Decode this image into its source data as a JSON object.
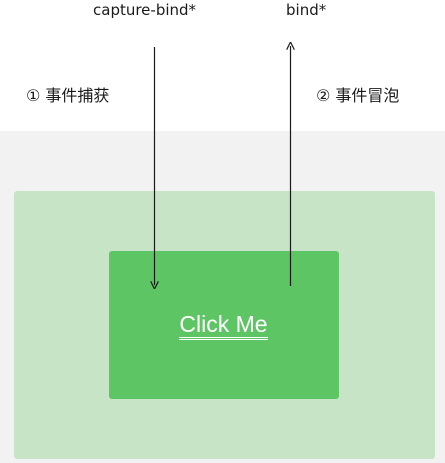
{
  "labels": {
    "capture_bind": "capture-bind*",
    "bind": "bind*",
    "capture_phase": "① 事件捕获",
    "bubble_phase": "② 事件冒泡"
  },
  "button": {
    "text": "Click Me"
  },
  "colors": {
    "background_band": "#f2f2f3",
    "outer_box": "#c7e5c6",
    "inner_box": "#5ec564",
    "arrow": "#1a1a1a",
    "button_text": "#ffffff"
  }
}
